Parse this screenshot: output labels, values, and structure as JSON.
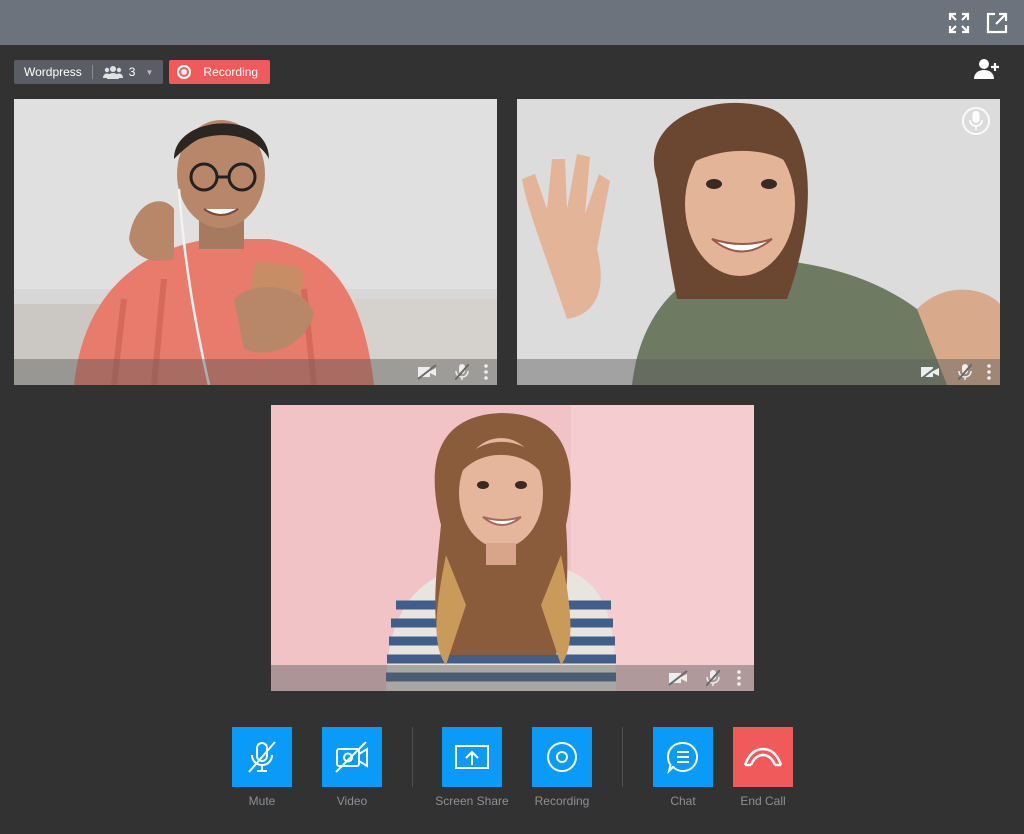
{
  "header": {
    "fullscreen_icon": "fullscreen-icon",
    "popout_icon": "external-link-icon"
  },
  "room": {
    "name": "Wordpress",
    "participant_count": "3",
    "recording_label": "Recording"
  },
  "participants": [
    {
      "name": "participant-1",
      "background": "#d9d9da",
      "shirt": "#e87b6b"
    },
    {
      "name": "participant-2",
      "background": "#dcdcdc",
      "shirt": "#6f7a63"
    },
    {
      "name": "participant-3",
      "background": "#f3c4c8",
      "shirt": "#3f5f8a"
    }
  ],
  "toolbar": {
    "mute_label": "Mute",
    "video_label": "Video",
    "screen_share_label": "Screen Share",
    "recording_label": "Recording",
    "chat_label": "Chat",
    "end_call_label": "End Call"
  },
  "colors": {
    "accent": "#0a9af8",
    "danger": "#f05a5a",
    "background": "#323232",
    "topbar": "#6c737c"
  }
}
